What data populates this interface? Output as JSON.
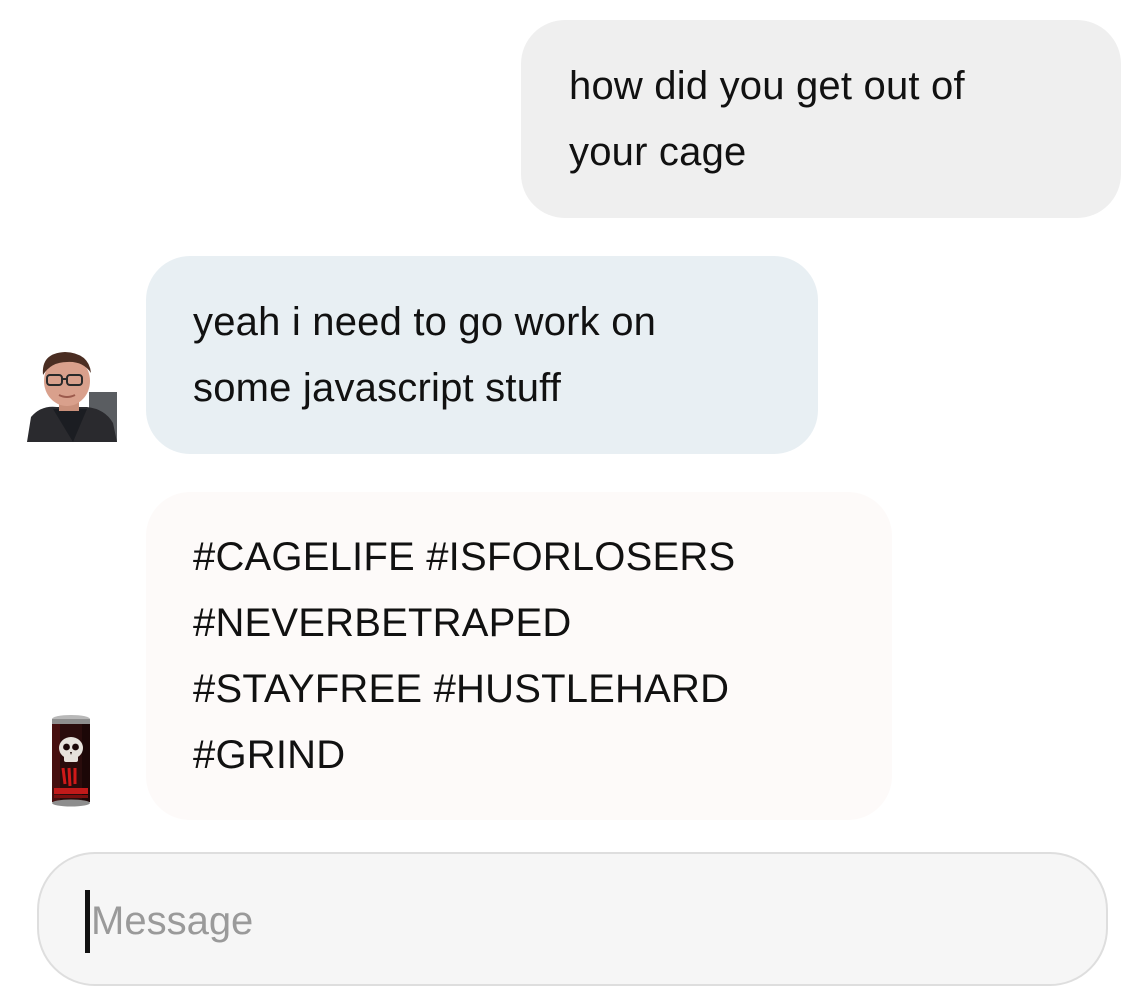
{
  "messages": [
    {
      "direction": "outgoing",
      "lines": [
        "how did you get out of",
        "your cage"
      ]
    },
    {
      "direction": "incoming",
      "sender_avatar": "person-photo-avatar",
      "lines": [
        "yeah i need to go work on",
        "some javascript stuff"
      ]
    },
    {
      "direction": "incoming",
      "sender_avatar": "energy-drink-can-avatar",
      "lines": [
        "#CAGELIFE #ISFORLOSERS",
        "#NEVERBETRAPED",
        "#STAYFREE #HUSTLEHARD",
        "#GRIND"
      ]
    }
  ],
  "composer": {
    "placeholder": "Message",
    "value": ""
  },
  "colors": {
    "outgoing_bubble": "#efefef",
    "incoming_bubble_1": "#e8eff3",
    "incoming_bubble_2": "#fdfaf9",
    "composer_bg": "#f6f6f6",
    "composer_border": "#dedede",
    "text": "#111111",
    "placeholder": "#9a9a9a"
  }
}
